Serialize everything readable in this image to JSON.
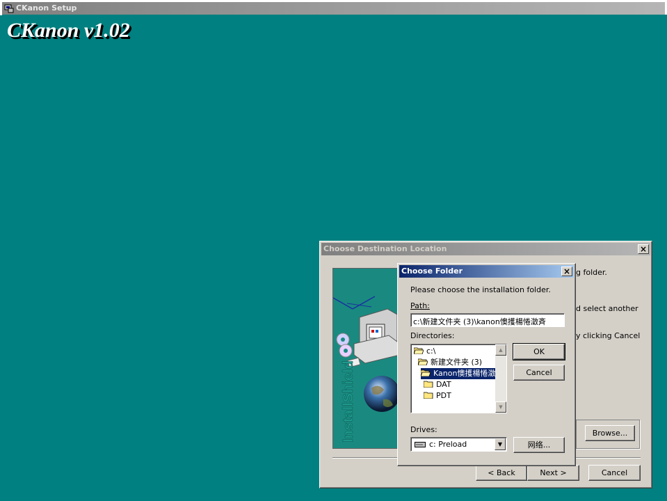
{
  "app": {
    "title": "CKanon Setup",
    "banner": "CKanon v1.02"
  },
  "destination_dialog": {
    "title": "Choose Destination Location",
    "side_image_text": "InstallShield",
    "partial_texts": [
      "g folder.",
      "d select another",
      "y clicking Cancel"
    ],
    "browse_label": "Browse...",
    "back_label": "< Back",
    "next_label": "Next >",
    "cancel_label": "Cancel"
  },
  "folder_dialog": {
    "title": "Choose Folder",
    "prompt": "Please choose the installation folder.",
    "path_label": "Path:",
    "path_value": "c:\\新建文件夹 (3)\\kanon懊擭楊惓澂斉",
    "directories_label": "Directories:",
    "directories": [
      {
        "name": "c:\\",
        "selected": false
      },
      {
        "name": "新建文件夹 (3)",
        "selected": false
      },
      {
        "name": "Kanon懊擭楊惓澂",
        "selected": true
      },
      {
        "name": "DAT",
        "selected": false
      },
      {
        "name": "PDT",
        "selected": false
      }
    ],
    "ok_label": "OK",
    "cancel_label": "Cancel",
    "drives_label": "Drives:",
    "drive_value": "c: Preload",
    "network_label": "网络..."
  },
  "colors": {
    "desktop": "#008080",
    "dialog": "#d4d0c8",
    "active_title": "#0a246a",
    "inactive_title": "#808080",
    "selection": "#0a246a"
  }
}
